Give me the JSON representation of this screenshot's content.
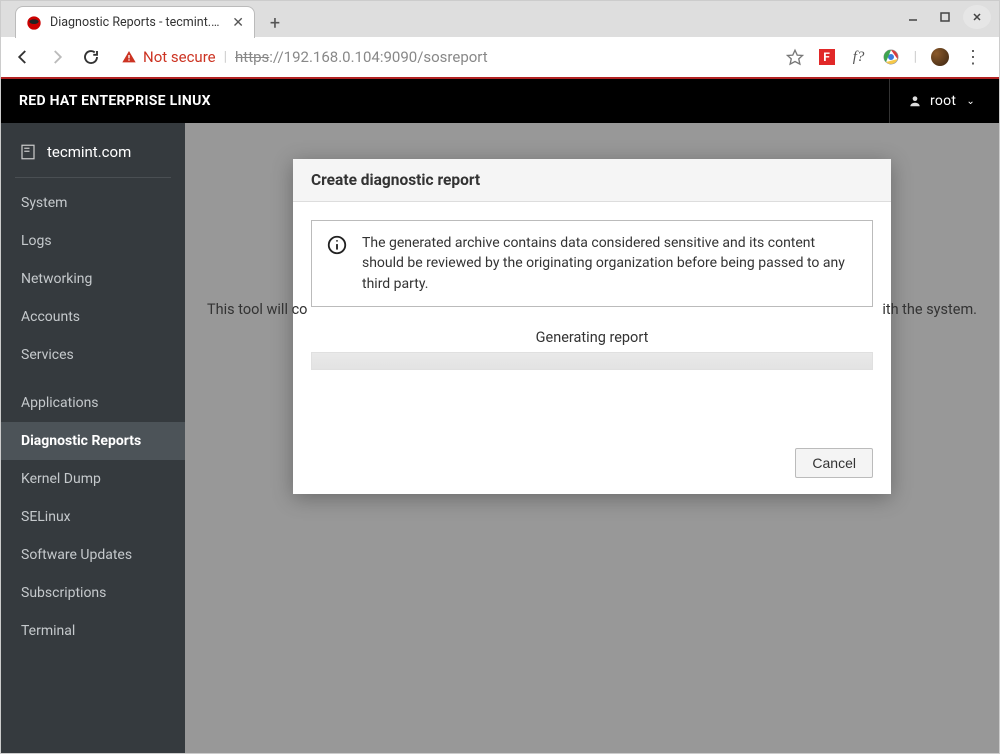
{
  "browser": {
    "tab_title": "Diagnostic Reports - tecmint.co",
    "not_secure_label": "Not secure",
    "url_scheme": "https",
    "url_host": "://192.168.0.104",
    "url_port": ":9090",
    "url_path": "/sosreport",
    "flipboard_label": "F",
    "fquestion_label": "f?"
  },
  "header": {
    "brand": "RED HAT ENTERPRISE LINUX",
    "user": "root"
  },
  "sidebar": {
    "host": "tecmint.com",
    "items": [
      {
        "label": "System"
      },
      {
        "label": "Logs"
      },
      {
        "label": "Networking"
      },
      {
        "label": "Accounts"
      },
      {
        "label": "Services"
      }
    ],
    "items2": [
      {
        "label": "Applications"
      },
      {
        "label": "Diagnostic Reports"
      },
      {
        "label": "Kernel Dump"
      },
      {
        "label": "SELinux"
      },
      {
        "label": "Software Updates"
      },
      {
        "label": "Subscriptions"
      },
      {
        "label": "Terminal"
      }
    ]
  },
  "main": {
    "tool_desc_left": "This tool will co",
    "tool_desc_right": "ith the system."
  },
  "modal": {
    "title": "Create diagnostic report",
    "info_text": "The generated archive contains data considered sensitive and its content should be reviewed by the originating organization before being passed to any third party.",
    "status": "Generating report",
    "cancel": "Cancel"
  }
}
